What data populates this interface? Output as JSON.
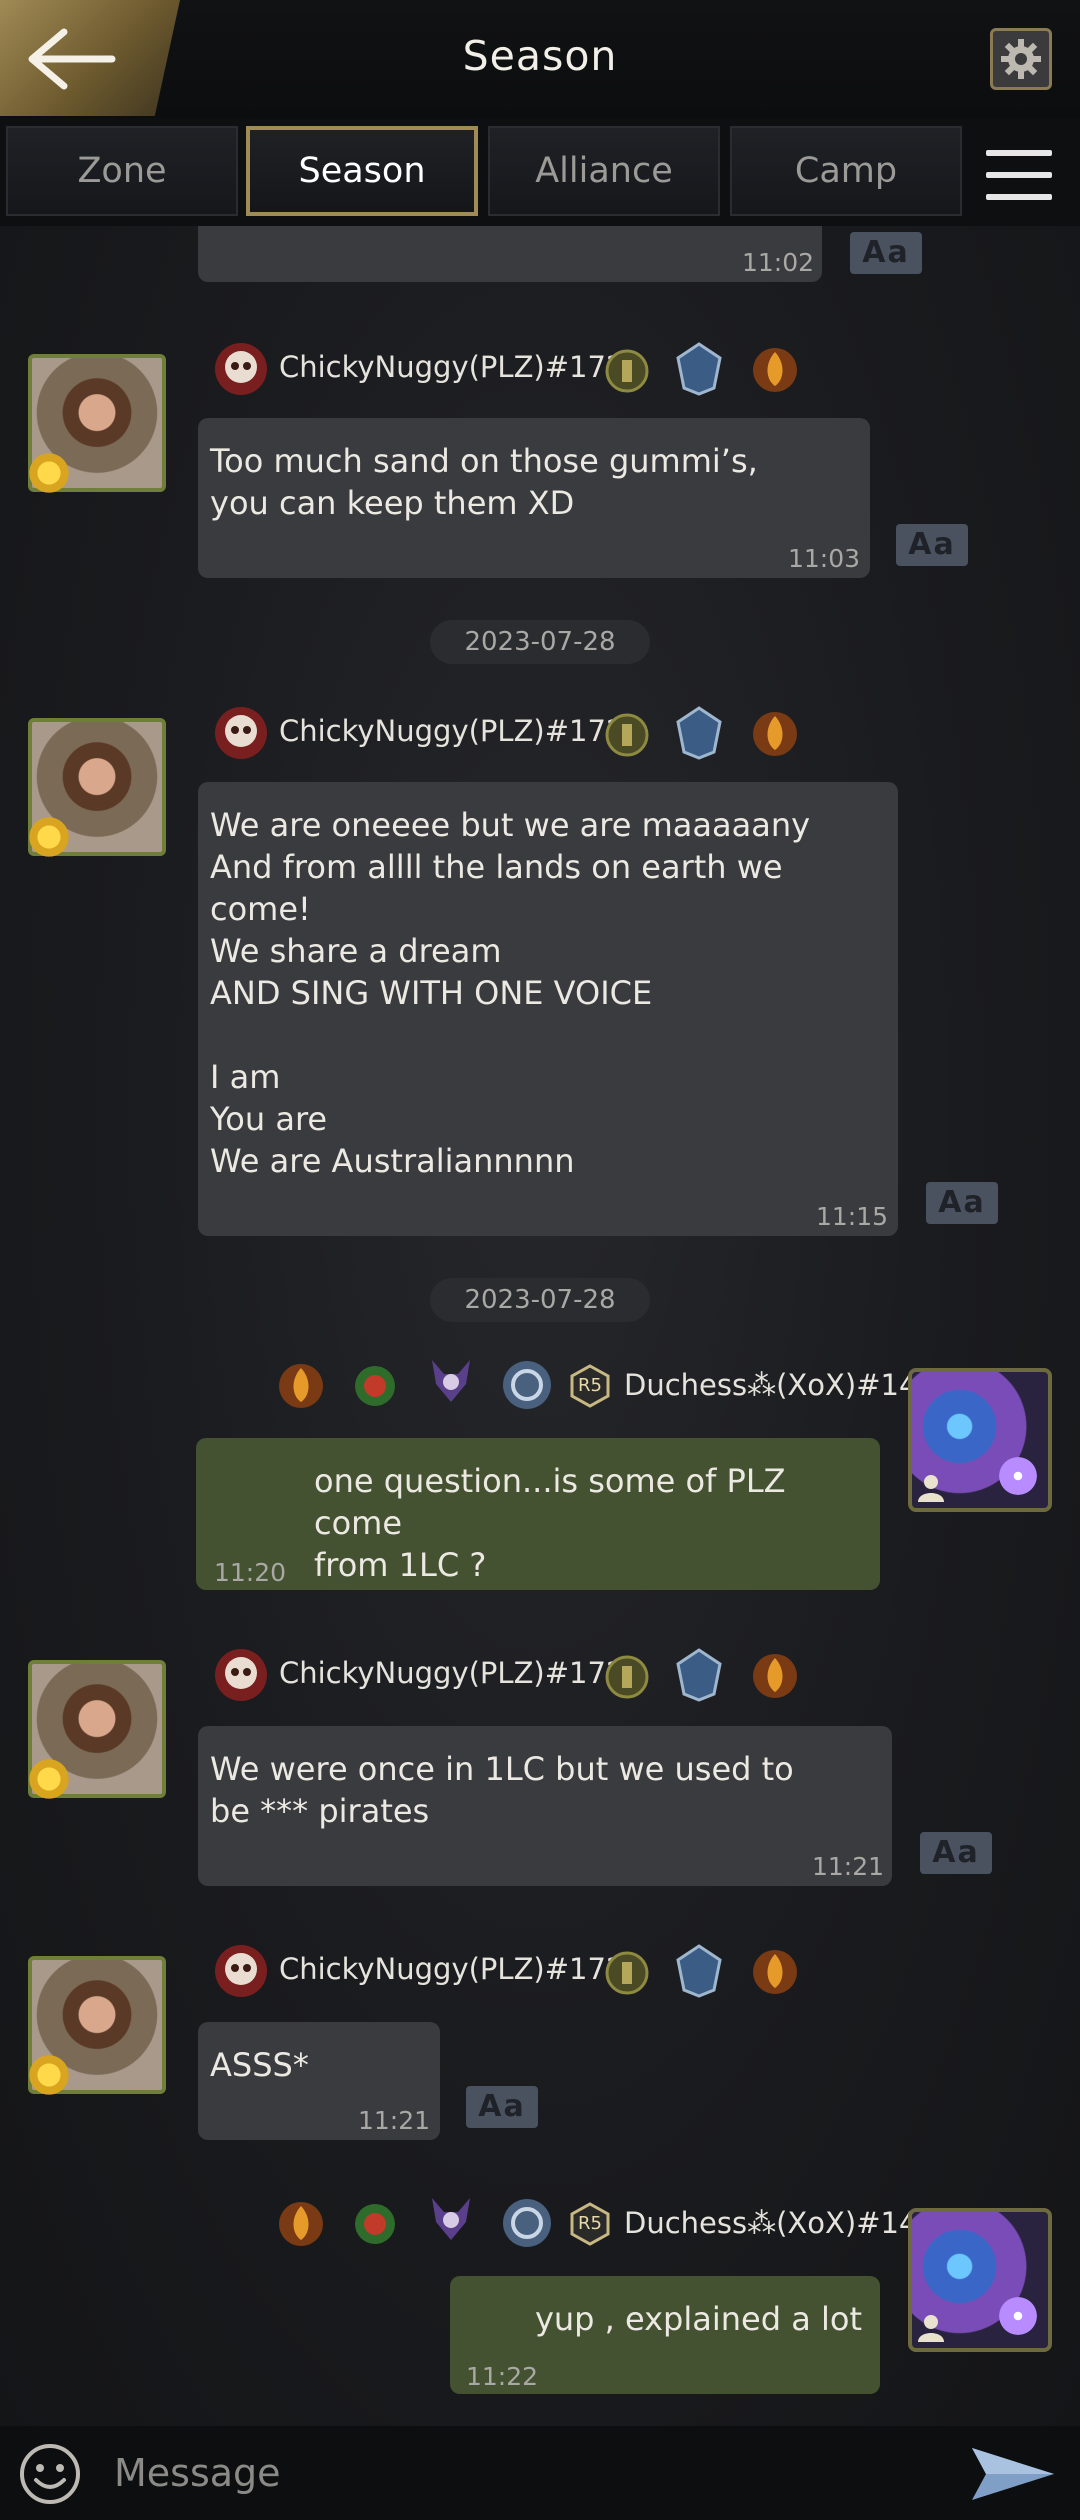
{
  "header": {
    "title": "Season"
  },
  "tabs": [
    {
      "label": "Zone"
    },
    {
      "label": "Season"
    },
    {
      "label": "Alliance"
    },
    {
      "label": "Camp"
    }
  ],
  "partial_top": {
    "time": "11:02"
  },
  "messages": [
    {
      "author": "ChickyNuggy(PLZ)#172",
      "text": "Too much sand on those gummi’s,\nyou can keep them XD",
      "time": "11:03"
    },
    {
      "author": "ChickyNuggy(PLZ)#172",
      "text": "We are oneeee but we are maaaaany\nAnd from allll the lands on earth we\ncome!\nWe share a dream\nAND SING WITH ONE VOICE\n\nI am\nYou are\nWe are Australiannnnn",
      "time": "11:15"
    },
    {
      "author": "Duchess⁂(XoX)#14",
      "text": "one question...is some of PLZ come\nfrom 1LC ?",
      "time": "11:20"
    },
    {
      "author": "ChickyNuggy(PLZ)#172",
      "text": "We were once in 1LC but we used to\nbe *** pirates",
      "time": "11:21"
    },
    {
      "author": "ChickyNuggy(PLZ)#172",
      "text": "ASSS*",
      "time": "11:21"
    },
    {
      "author": "Duchess⁂(XoX)#14",
      "text": "yup , explained a lot",
      "time": "11:22"
    }
  ],
  "dates": [
    "2023-07-28",
    "2023-07-28"
  ],
  "translate_label": "Aa",
  "rank_badge": "R5",
  "input": {
    "placeholder": "Message"
  },
  "colors": {
    "accent_gold": "#a08a55",
    "own_bubble": "#445232",
    "other_bubble": "#3a3b3e"
  }
}
